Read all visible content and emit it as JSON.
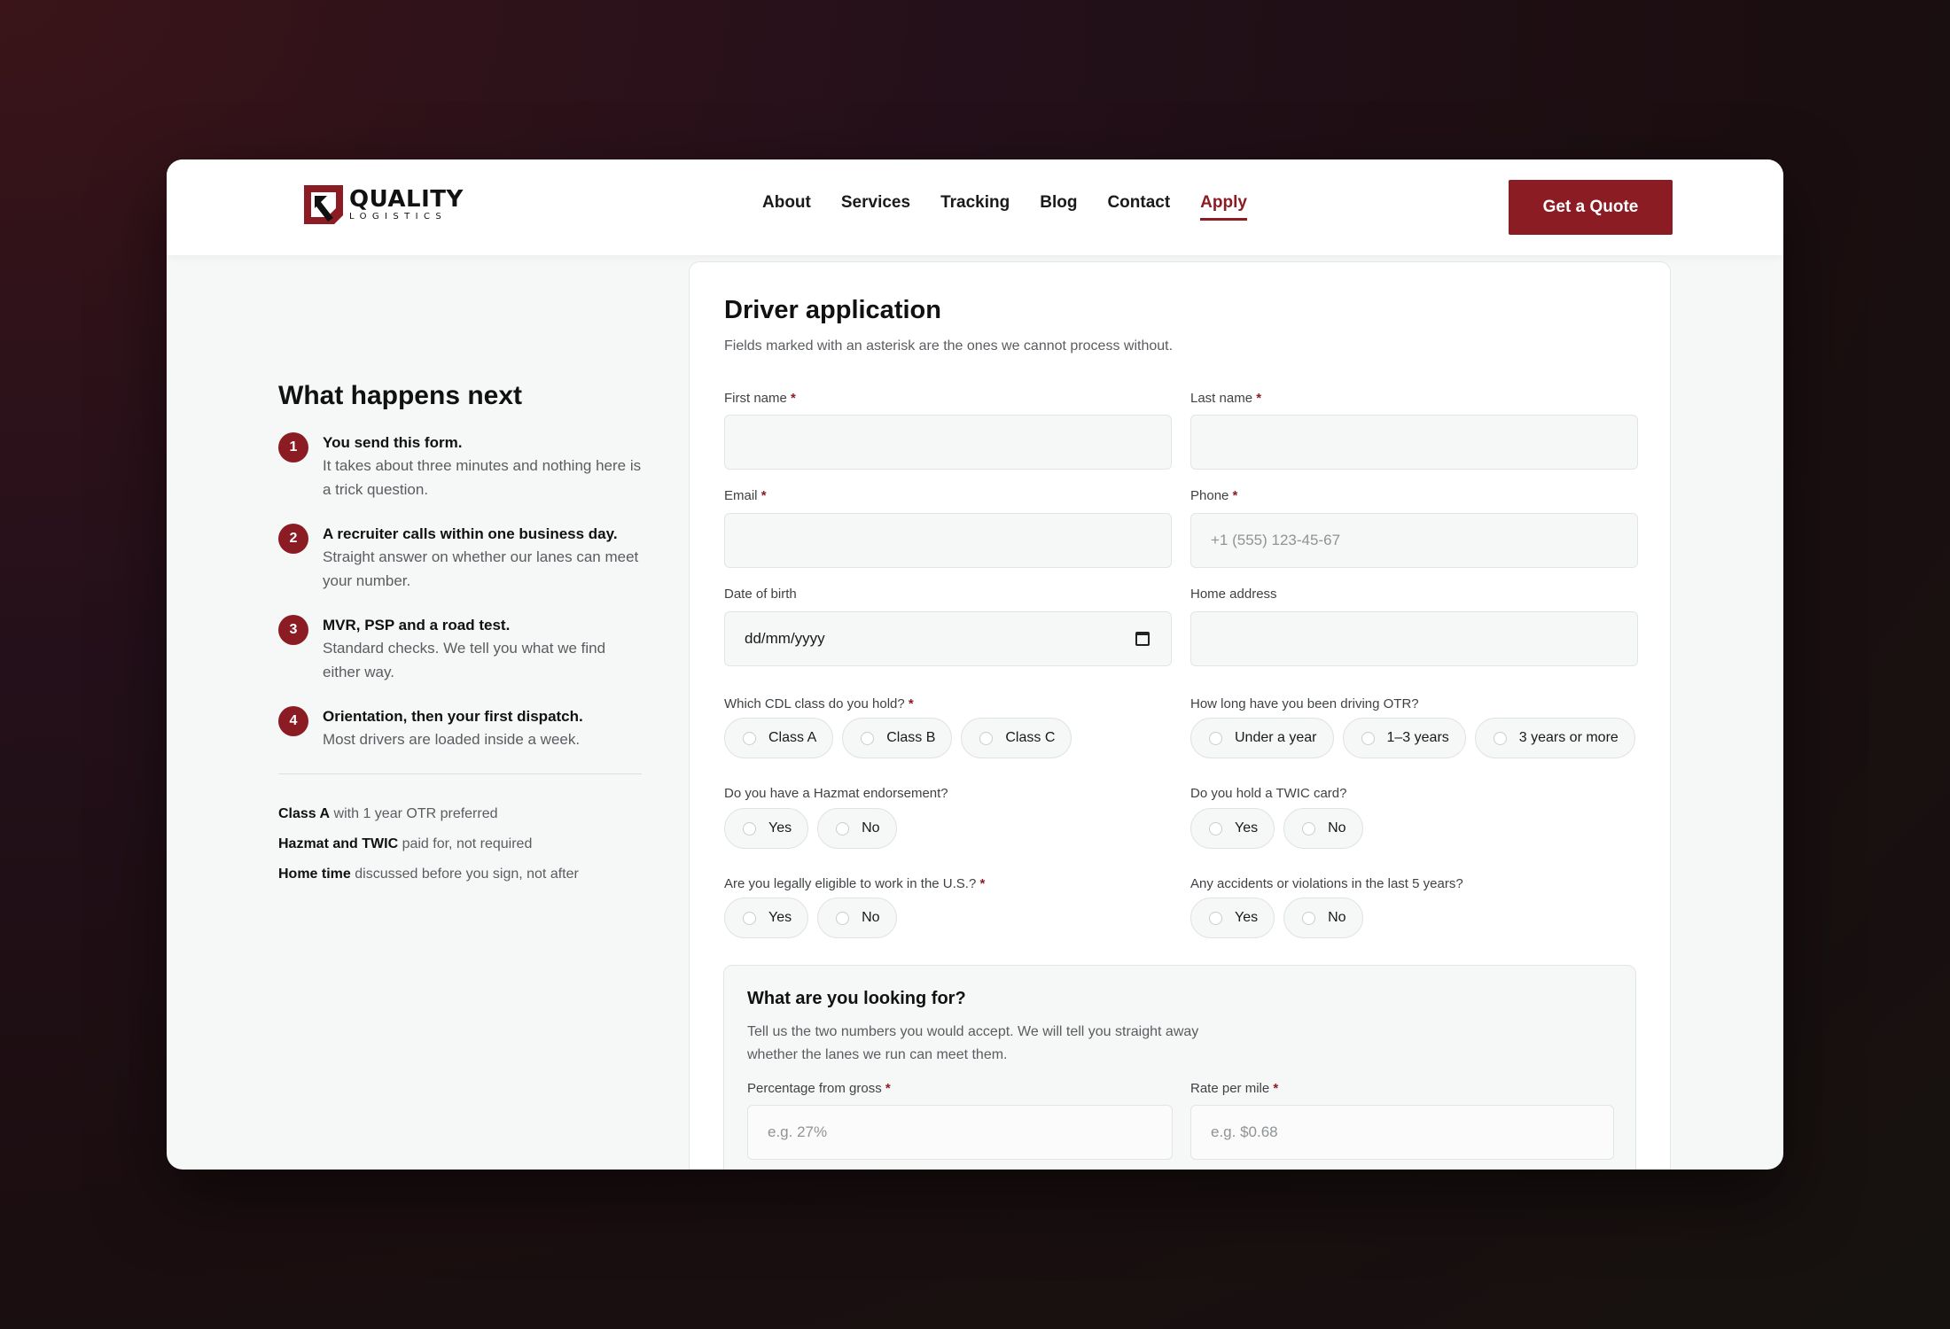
{
  "brand": {
    "name": "QUALITY",
    "tagline": "LOGISTICS",
    "color": "#8c1c23"
  },
  "nav": {
    "items": [
      {
        "label": "About"
      },
      {
        "label": "Services"
      },
      {
        "label": "Tracking"
      },
      {
        "label": "Blog"
      },
      {
        "label": "Contact"
      },
      {
        "label": "Apply",
        "active": true
      }
    ],
    "cta": "Get a Quote"
  },
  "sidebar": {
    "title": "What happens next",
    "steps": [
      {
        "num": "1",
        "title": "You send this form.",
        "desc": "It takes about three minutes and nothing here is a trick question."
      },
      {
        "num": "2",
        "title": "A recruiter calls within one business day.",
        "desc": "Straight answer on whether our lanes can meet your number."
      },
      {
        "num": "3",
        "title": "MVR, PSP and a road test.",
        "desc": "Standard checks. We tell you what we find either way."
      },
      {
        "num": "4",
        "title": "Orientation, then your first dispatch.",
        "desc": "Most drivers are loaded inside a week."
      }
    ],
    "perks": [
      {
        "bold": "Class A",
        "rest": " with 1 year OTR preferred"
      },
      {
        "bold": "Hazmat and TWIC",
        "rest": " paid for, not required"
      },
      {
        "bold": "Home time",
        "rest": " discussed before you sign, not after"
      }
    ]
  },
  "form": {
    "title": "Driver application",
    "lead": "Fields marked with an asterisk are the ones we cannot process without.",
    "required_mark": "*",
    "first_name": {
      "label": "First name"
    },
    "last_name": {
      "label": "Last name"
    },
    "email": {
      "label": "Email"
    },
    "phone": {
      "label": "Phone",
      "placeholder": "+1 (555) 123-45-67"
    },
    "dob": {
      "label": "Date of birth",
      "value": "dd/mm/yyyy"
    },
    "address": {
      "label": "Home address"
    },
    "cdl": {
      "label": "Which CDL class do you hold?",
      "options": [
        "Class A",
        "Class B",
        "Class C"
      ]
    },
    "otr": {
      "label": "How long have you been driving OTR?",
      "options": [
        "Under a year",
        "1–3 years",
        "3 years or more"
      ]
    },
    "hazmat": {
      "label": "Do you have a Hazmat endorsement?",
      "options": [
        "Yes",
        "No"
      ]
    },
    "twic": {
      "label": "Do you hold a TWIC card?",
      "options": [
        "Yes",
        "No"
      ]
    },
    "eligible": {
      "label": "Are you legally eligible to work in the U.S.?",
      "options": [
        "Yes",
        "No"
      ]
    },
    "accidents": {
      "label": "Any accidents or violations in the last 5 years?",
      "options": [
        "Yes",
        "No"
      ]
    },
    "looking": {
      "title": "What are you looking for?",
      "desc": "Tell us the two numbers you would accept. We will tell you straight away whether the lanes we run can meet them.",
      "percentage": {
        "label": "Percentage from gross",
        "placeholder": "e.g. 27%"
      },
      "rate": {
        "label": "Rate per mile",
        "placeholder": "e.g. $0.68"
      }
    }
  }
}
